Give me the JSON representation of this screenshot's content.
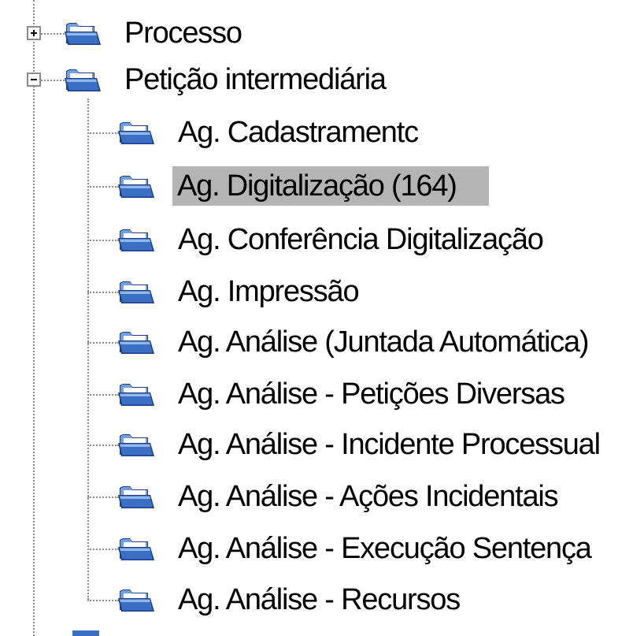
{
  "tree": {
    "root_nodes": [
      {
        "label": "Processo",
        "expanded": false
      },
      {
        "label": "Petição intermediária",
        "expanded": true,
        "children": [
          {
            "label": "Ag. Cadastramentc",
            "selected": false
          },
          {
            "label": "Ag. Digitalização (164)",
            "selected": true
          },
          {
            "label": "Ag. Conferência Digitalização",
            "selected": false
          },
          {
            "label": "Ag. Impressão",
            "selected": false
          },
          {
            "label": "Ag. Análise (Juntada Automática)",
            "selected": false
          },
          {
            "label": "Ag. Análise - Petições Diversas",
            "selected": false
          },
          {
            "label": "Ag. Análise - Incidente Processual",
            "selected": false
          },
          {
            "label": "Ag. Análise - Ações Incidentais",
            "selected": false
          },
          {
            "label": "Ag. Análise - Execução Sentença",
            "selected": false
          },
          {
            "label": "Ag. Análise - Recursos",
            "selected": false
          }
        ]
      }
    ],
    "icons": {
      "folder": "open-folder-icon",
      "expand": "plus-icon",
      "collapse": "minus-icon"
    },
    "colors": {
      "selection": "#b4b4b4",
      "folder_blue": "#3a6fc4",
      "folder_dark": "#1b3f8a",
      "tree_lines": "#8c8c8c"
    }
  }
}
